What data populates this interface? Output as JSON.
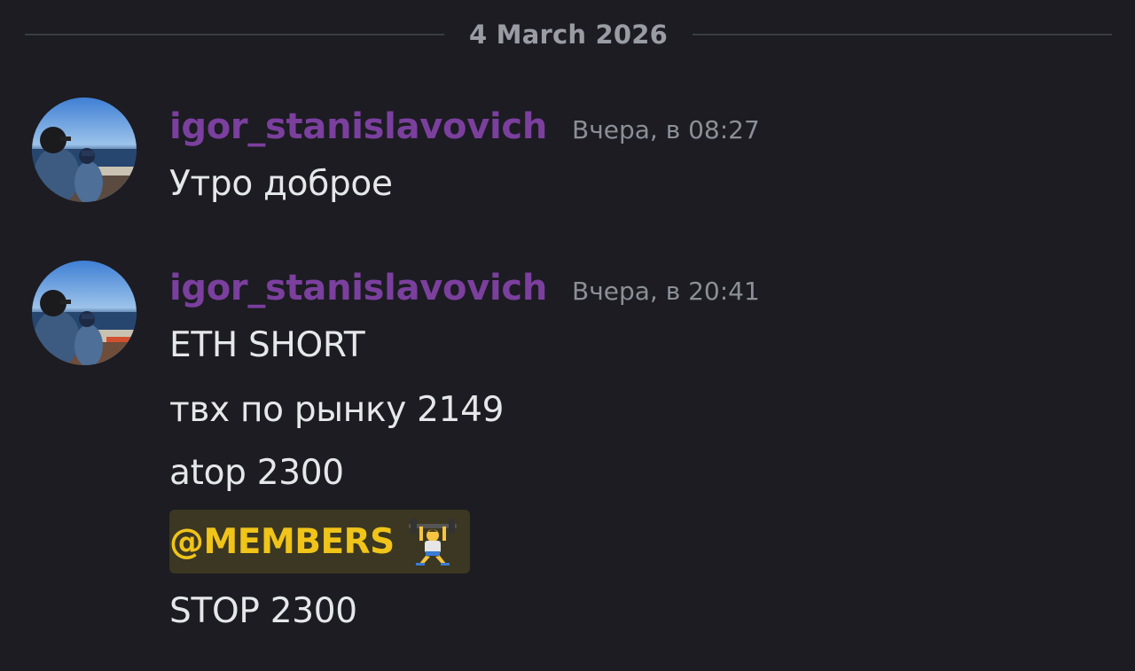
{
  "date_divider": "4 March 2026",
  "messages": [
    {
      "username": "igor_stanislavovich",
      "timestamp": "Вчера, в 08:27",
      "lines": [
        "Утро доброе"
      ]
    },
    {
      "username": "igor_stanislavovich",
      "timestamp": "Вчера, в 20:41",
      "lines": [
        "ETH SHORT",
        "твх по рынку 2149",
        "atop 2300"
      ],
      "mention": "@MEMBERS",
      "mention_emoji": "weightlifter-emoji",
      "after_mention": "STOP 2300"
    }
  ],
  "colors": {
    "background": "#1c1c22",
    "username": "#7b3f9e",
    "mention_text": "#f0c419",
    "mention_bg": "#3b3722"
  }
}
